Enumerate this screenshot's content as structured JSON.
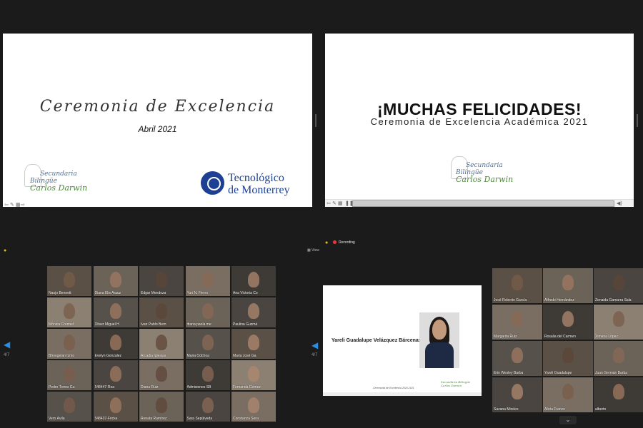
{
  "slide1": {
    "title": "Ceremonia de Excelencia",
    "date": "Abril 2021",
    "school_line1": "Secundaria",
    "school_line2": "Bilingüe",
    "school_line3": "Carlos Darwin",
    "tec_line1": "Tecnológico",
    "tec_line2": "de Monterrey"
  },
  "slide2": {
    "headline": "¡MUCHAS FELICIDADES!",
    "subheadline": "Ceremonia de Excelencia Académica 2021",
    "school_line1": "Secundaria",
    "school_line2": "Bilingüe",
    "school_line3": "Carlos Darwin"
  },
  "gallery_left": {
    "view_label": "View",
    "page_left": "4/7",
    "participants": [
      "Naojo Bennett",
      "Diana Elis Arauz",
      "Edgar Mendoza",
      "Yuri N. Fierro",
      "Ana Victoria Co",
      "Mónica Coronel",
      "Oliver Miguel H",
      "Ivan Pablo Bern",
      "diana paola me",
      "Paulina Guzmá",
      "Bhoogelan Izmo",
      "Evelyn Gonzalez",
      "Arcadia Iglesias",
      "Maria Odchoa",
      "Maria José Ga",
      "Pedro Torres Gu",
      "548447-Rea",
      "Diana Ruiz",
      "Admisiones SB",
      "Fernanda Gómez",
      "Vero Ávila",
      "548437-Fricke",
      "Renata Ramírez",
      "Sara Sepúlveda",
      "Constanza Sera"
    ]
  },
  "gallery_right": {
    "recording_label": "Recording",
    "page_left": "4/7",
    "participants": [
      "José Roberto García",
      "Alfredo Hernández",
      "Zenaida Gamarra Sala",
      "Margarita Ruiz",
      "Rosalia del Carmen",
      "Ximena López",
      "Erin Wesley Barba",
      "Yareli Guadalupe",
      "Juan Germán Barba",
      "Suzana Mireles",
      "Alicia Franco",
      "alberto"
    ],
    "mini_slide_name": "Yareli Guadalupe Velázquez Bárcenas",
    "mini_slide_caption": "Ceremonia de Excelencia 2020-2021",
    "mini_slide_logo1": "Secundaria Bilingüe",
    "mini_slide_logo2": "Carlos Darwin",
    "scroll_icon": "chevron-down-icon"
  },
  "colors": {
    "background": "#1b1b1b",
    "tec_blue": "#1d3f94",
    "school_green": "#4d8a3a",
    "school_blue": "#4a6f9a",
    "nav_blue": "#2b8de0",
    "recording_red": "#e03b3b"
  }
}
